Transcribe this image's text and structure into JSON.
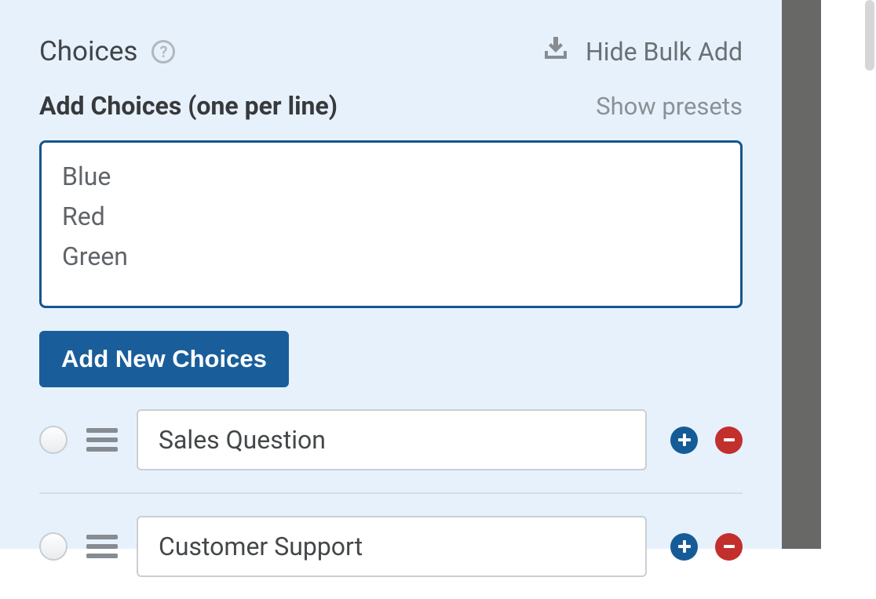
{
  "header": {
    "title": "Choices",
    "help_symbol": "?",
    "hide_bulk_label": "Hide Bulk Add"
  },
  "subheader": {
    "add_choices_label": "Add Choices (one per line)",
    "show_presets_label": "Show presets"
  },
  "bulk": {
    "textarea_value": "Blue\nRed\nGreen",
    "add_button_label": "Add New Choices"
  },
  "choices": [
    {
      "value": "Sales Question"
    },
    {
      "value": "Customer Support"
    }
  ]
}
